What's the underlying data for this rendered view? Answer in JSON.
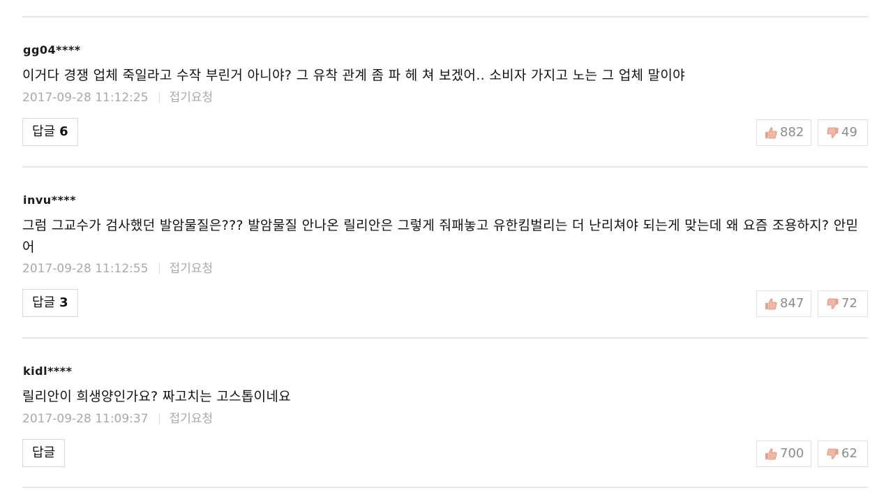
{
  "colors": {
    "like_icon": "#e8a18a",
    "dislike_icon": "#e8a18a",
    "meta_text": "#a9a9a9",
    "divider": "#e6e6e6"
  },
  "comments": [
    {
      "author": "gg04****",
      "text": "이거다 경쟁 업체 죽일라고 수작 부린거 아니야? 그 유착 관계 좀 파 헤 쳐 보겠어.. 소비자 가지고 노는 그 업체 말이야",
      "timestamp": "2017-09-28 11:12:25",
      "report_label": "접기요청",
      "reply_label": "답글",
      "reply_count": "6",
      "likes": "882",
      "dislikes": "49"
    },
    {
      "author": "invu****",
      "text": "그럼 그교수가 검사했던 발암물질은??? 발암물질 안나온 릴리안은 그렇게 줘패놓고 유한킴벌리는 더 난리쳐야 되는게 맞는데 왜 요즘 조용하지? 안믿어",
      "timestamp": "2017-09-28 11:12:55",
      "report_label": "접기요청",
      "reply_label": "답글",
      "reply_count": "3",
      "likes": "847",
      "dislikes": "72"
    },
    {
      "author": "kidl****",
      "text": "릴리안이 희생양인가요? 짜고치는 고스톱이네요",
      "timestamp": "2017-09-28 11:09:37",
      "report_label": "접기요청",
      "reply_label": "답글",
      "reply_count": "",
      "likes": "700",
      "dislikes": "62"
    }
  ]
}
